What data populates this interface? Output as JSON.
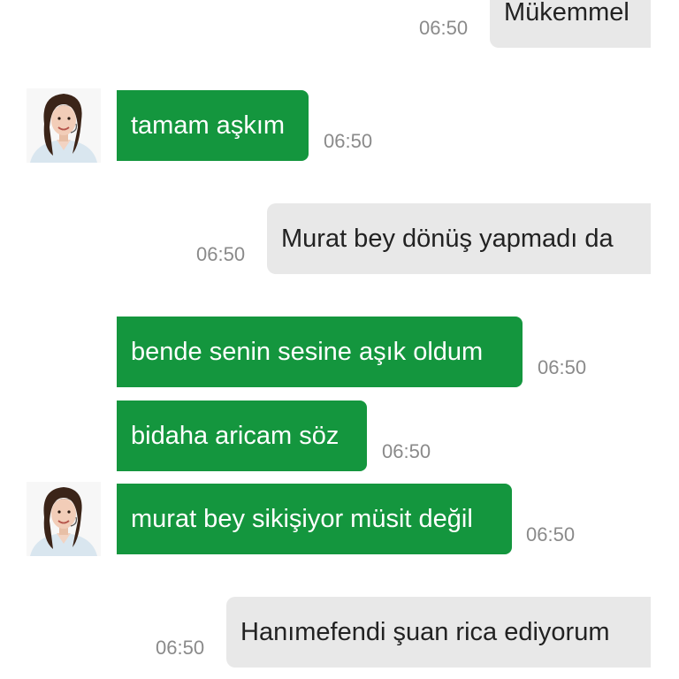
{
  "messages": [
    {
      "text": "Mükemmel",
      "time": "06:50"
    },
    {
      "text": "tamam aşkım",
      "time": "06:50"
    },
    {
      "text": "Murat bey dönüş yapmadı da",
      "time": "06:50"
    },
    {
      "text": "bende senin sesine aşık oldum",
      "time": "06:50"
    },
    {
      "text": "bidaha aricam söz",
      "time": "06:50"
    },
    {
      "text": "murat bey sikişiyor müsit değil",
      "time": "06:50"
    },
    {
      "text": "Hanımefendi şuan rica ediyorum",
      "time": "06:50"
    }
  ],
  "colors": {
    "incoming_bubble": "#14963e",
    "outgoing_bubble": "#e8e8e8",
    "timestamp": "#8a8a8a"
  },
  "icons": {
    "avatar": "contact-avatar-woman"
  }
}
